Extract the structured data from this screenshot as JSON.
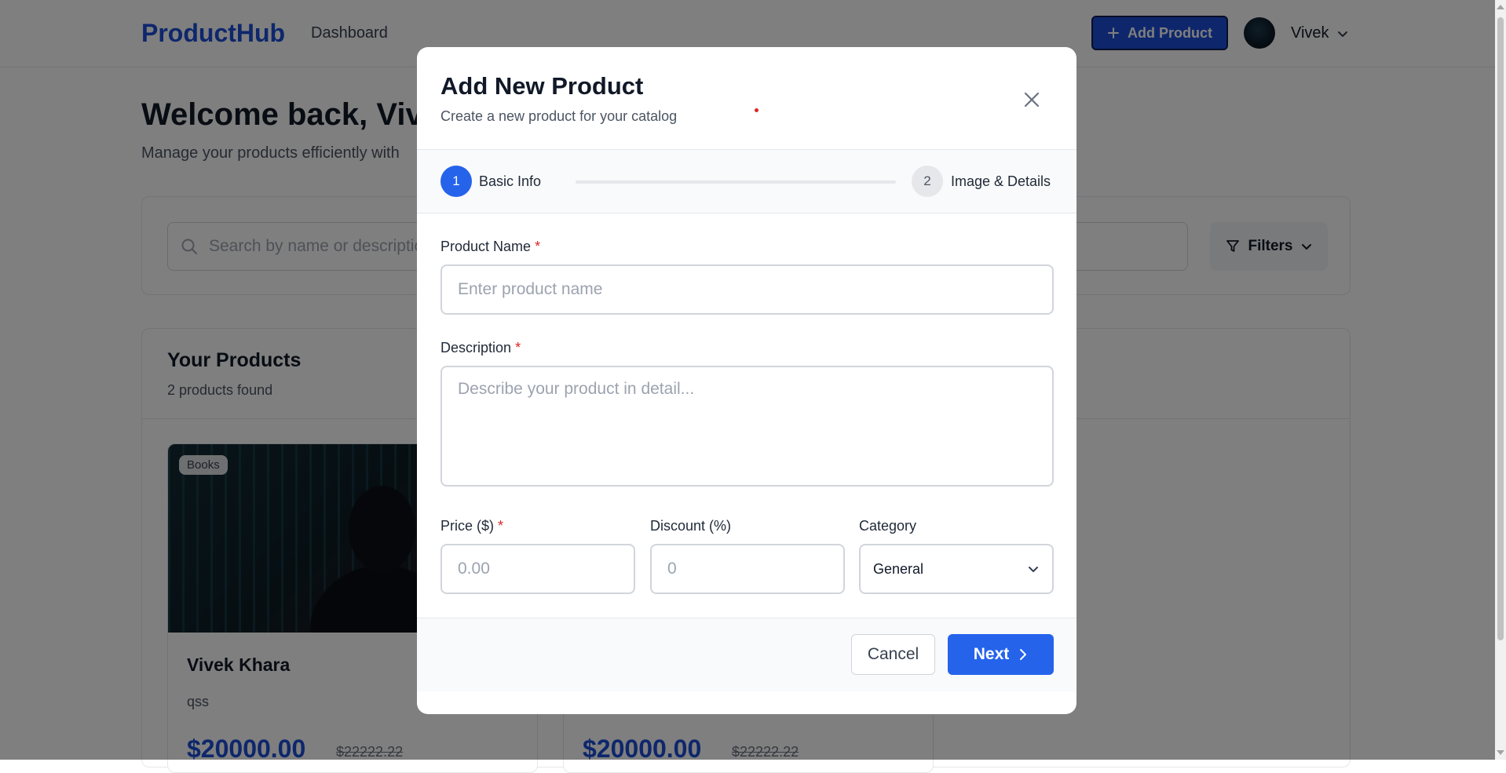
{
  "nav": {
    "brand": "ProductHub",
    "dashboard_link": "Dashboard",
    "add_product_label": "Add Product",
    "user_name": "Vivek"
  },
  "welcome": {
    "title": "Welcome back, Vivek",
    "subtitle": "Manage your products efficiently with"
  },
  "search": {
    "placeholder": "Search by name or description",
    "filters_label": "Filters"
  },
  "products": {
    "title": "Your Products",
    "count": "2 products found",
    "items": [
      {
        "badge": "Books",
        "name": "Vivek Khara",
        "description": "qss",
        "price": "$20000.00",
        "old_price": "$22222.22"
      },
      {
        "badge": "",
        "name": "",
        "description": "",
        "price": "$20000.00",
        "old_price": "$22222.22"
      }
    ]
  },
  "modal": {
    "title": "Add New Product",
    "subtitle": "Create a new product for your catalog",
    "steps": [
      {
        "number": "1",
        "label": "Basic Info"
      },
      {
        "number": "2",
        "label": "Image & Details"
      }
    ],
    "fields": {
      "product_name": {
        "label": "Product Name",
        "required_mark": "*",
        "placeholder": "Enter product name",
        "value": ""
      },
      "description": {
        "label": "Description",
        "required_mark": "*",
        "placeholder": "Describe your product in detail...",
        "value": ""
      },
      "price": {
        "label": "Price ($)",
        "required_mark": "*",
        "placeholder": "0.00",
        "value": ""
      },
      "discount": {
        "label": "Discount (%)",
        "placeholder": "0",
        "value": ""
      },
      "category": {
        "label": "Category",
        "value": "General"
      }
    },
    "cancel_label": "Cancel",
    "next_label": "Next"
  },
  "colors": {
    "primary": "#2563eb",
    "brand": "#1d4ed8",
    "required": "#dc2626"
  }
}
